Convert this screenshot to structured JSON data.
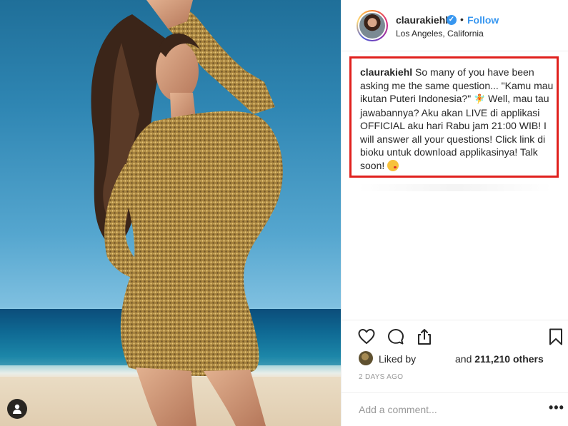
{
  "post": {
    "author": "claurakiehl",
    "verified_icon": "verified-badge-icon",
    "separator": "•",
    "follow_label": "Follow",
    "location": "Los Angeles, California",
    "caption": {
      "username": "claurakiehl",
      "text_part1": "So many of you have been asking me the same question... \"Kamu mau ikutan Puteri Indonesia?\"",
      "text_part2": "Well, mau tau jawabannya? Aku akan LIVE di applikasi OFFICIAL aku hari Rabu jam 21:00 WIB! I will answer all your questions! Click link di bioku untuk download applikasinya! Talk soon!",
      "emoji_1": "fairy-emoji-icon",
      "emoji_2": "kissing-face-emoji-icon"
    },
    "highlight_color": "#e0201d",
    "likes": {
      "liked_by_label": "Liked by",
      "and_label": "and",
      "count": "211,210 others"
    },
    "timestamp": "2 DAYS AGO",
    "comment_placeholder": "Add a comment...",
    "more_label": "•••"
  },
  "colors": {
    "link_blue": "#3897f0",
    "text": "#262626",
    "muted": "#999999",
    "border": "#efefef"
  }
}
